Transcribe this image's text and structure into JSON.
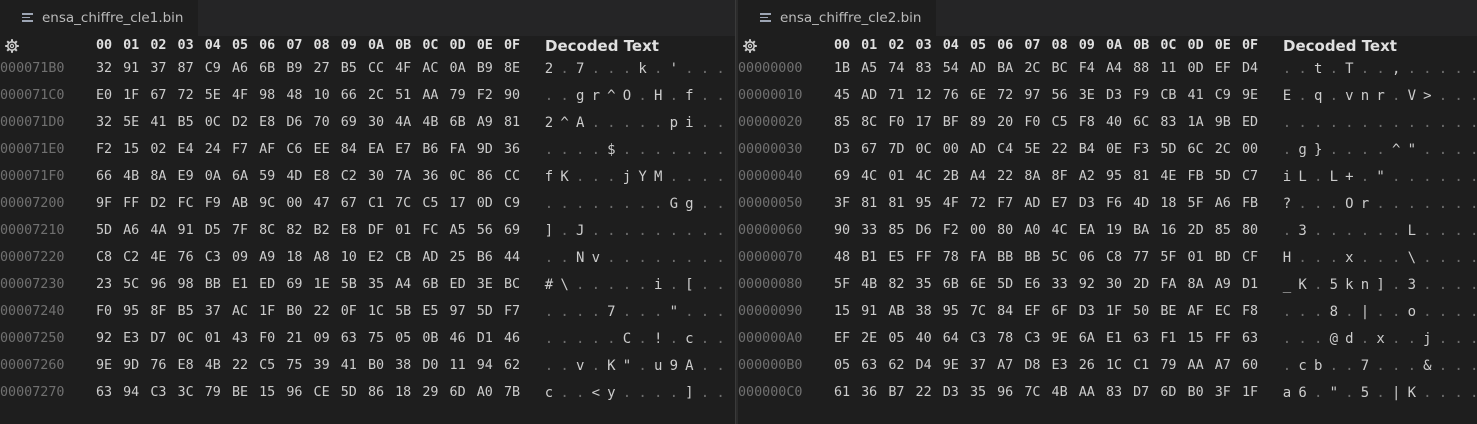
{
  "panes": [
    {
      "id": "left",
      "tab_title": "ensa_chiffre_cle1.bin",
      "header": {
        "columns": [
          "00",
          "01",
          "02",
          "03",
          "04",
          "05",
          "06",
          "07",
          "08",
          "09",
          "0A",
          "0B",
          "0C",
          "0D",
          "0E",
          "0F"
        ],
        "decoded_label": "Decoded Text"
      },
      "rows": [
        {
          "address": "000071B0",
          "bytes": [
            "32",
            "91",
            "37",
            "87",
            "C9",
            "A6",
            "6B",
            "B9",
            "27",
            "B5",
            "CC",
            "4F",
            "AC",
            "0A",
            "B9",
            "8E"
          ],
          "decoded": [
            "2",
            ".",
            "7",
            ".",
            ".",
            ".",
            "k",
            ".",
            "'",
            ".",
            ".",
            ".",
            ".",
            ".",
            ".",
            "."
          ]
        },
        {
          "address": "000071C0",
          "bytes": [
            "E0",
            "1F",
            "67",
            "72",
            "5E",
            "4F",
            "98",
            "48",
            "10",
            "66",
            "2C",
            "51",
            "AA",
            "79",
            "F2",
            "90"
          ],
          "decoded": [
            ".",
            ".",
            "g",
            "r",
            "^",
            "O",
            ".",
            "H",
            ".",
            "f",
            ".",
            ".",
            ".",
            ".",
            ".",
            "."
          ]
        },
        {
          "address": "000071D0",
          "bytes": [
            "32",
            "5E",
            "41",
            "B5",
            "0C",
            "D2",
            "E8",
            "D6",
            "70",
            "69",
            "30",
            "4A",
            "4B",
            "6B",
            "A9",
            "81"
          ],
          "decoded": [
            "2",
            "^",
            "A",
            ".",
            ".",
            ".",
            ".",
            ".",
            "p",
            "i",
            ".",
            ".",
            ".",
            ".",
            ".",
            "."
          ]
        },
        {
          "address": "000071E0",
          "bytes": [
            "F2",
            "15",
            "02",
            "E4",
            "24",
            "F7",
            "AF",
            "C6",
            "EE",
            "84",
            "EA",
            "E7",
            "B6",
            "FA",
            "9D",
            "36"
          ],
          "decoded": [
            ".",
            ".",
            ".",
            ".",
            "$",
            ".",
            ".",
            ".",
            ".",
            ".",
            ".",
            ".",
            ".",
            ".",
            ".",
            "."
          ]
        },
        {
          "address": "000071F0",
          "bytes": [
            "66",
            "4B",
            "8A",
            "E9",
            "0A",
            "6A",
            "59",
            "4D",
            "E8",
            "C2",
            "30",
            "7A",
            "36",
            "0C",
            "86",
            "CC"
          ],
          "decoded": [
            "f",
            "K",
            ".",
            ".",
            ".",
            "j",
            "Y",
            "M",
            ".",
            ".",
            ".",
            ".",
            ".",
            ".",
            ".",
            "."
          ]
        },
        {
          "address": "00007200",
          "bytes": [
            "9F",
            "FF",
            "D2",
            "FC",
            "F9",
            "AB",
            "9C",
            "00",
            "47",
            "67",
            "C1",
            "7C",
            "C5",
            "17",
            "0D",
            "C9"
          ],
          "decoded": [
            ".",
            ".",
            ".",
            ".",
            ".",
            ".",
            ".",
            ".",
            "G",
            "g",
            ".",
            ".",
            ".",
            ".",
            ".",
            "."
          ]
        },
        {
          "address": "00007210",
          "bytes": [
            "5D",
            "A6",
            "4A",
            "91",
            "D5",
            "7F",
            "8C",
            "82",
            "B2",
            "E8",
            "DF",
            "01",
            "FC",
            "A5",
            "56",
            "69"
          ],
          "decoded": [
            "]",
            ".",
            "J",
            ".",
            ".",
            ".",
            ".",
            ".",
            ".",
            ".",
            ".",
            ".",
            ".",
            ".",
            ".",
            "."
          ]
        },
        {
          "address": "00007220",
          "bytes": [
            "C8",
            "C2",
            "4E",
            "76",
            "C3",
            "09",
            "A9",
            "18",
            "A8",
            "10",
            "E2",
            "CB",
            "AD",
            "25",
            "B6",
            "44"
          ],
          "decoded": [
            ".",
            ".",
            "N",
            "v",
            ".",
            ".",
            ".",
            ".",
            ".",
            ".",
            ".",
            ".",
            ".",
            ".",
            ".",
            "."
          ]
        },
        {
          "address": "00007230",
          "bytes": [
            "23",
            "5C",
            "96",
            "98",
            "BB",
            "E1",
            "ED",
            "69",
            "1E",
            "5B",
            "35",
            "A4",
            "6B",
            "ED",
            "3E",
            "BC"
          ],
          "decoded": [
            "#",
            "\\",
            ".",
            ".",
            ".",
            ".",
            ".",
            "i",
            ".",
            "[",
            ".",
            ".",
            ".",
            ".",
            ".",
            "."
          ]
        },
        {
          "address": "00007240",
          "bytes": [
            "F0",
            "95",
            "8F",
            "B5",
            "37",
            "AC",
            "1F",
            "B0",
            "22",
            "0F",
            "1C",
            "5B",
            "E5",
            "97",
            "5D",
            "F7"
          ],
          "decoded": [
            ".",
            ".",
            ".",
            ".",
            "7",
            ".",
            ".",
            ".",
            "\"",
            ".",
            ".",
            ".",
            ".",
            ".",
            ".",
            "."
          ]
        },
        {
          "address": "00007250",
          "bytes": [
            "92",
            "E3",
            "D7",
            "0C",
            "01",
            "43",
            "F0",
            "21",
            "09",
            "63",
            "75",
            "05",
            "0B",
            "46",
            "D1",
            "46"
          ],
          "decoded": [
            ".",
            ".",
            ".",
            ".",
            ".",
            "C",
            ".",
            "!",
            ".",
            "c",
            ".",
            ".",
            ".",
            ".",
            ".",
            "."
          ]
        },
        {
          "address": "00007260",
          "bytes": [
            "9E",
            "9D",
            "76",
            "E8",
            "4B",
            "22",
            "C5",
            "75",
            "39",
            "41",
            "B0",
            "38",
            "D0",
            "11",
            "94",
            "62"
          ],
          "decoded": [
            ".",
            ".",
            "v",
            ".",
            "K",
            "\"",
            ".",
            "u",
            "9",
            "A",
            ".",
            ".",
            ".",
            ".",
            ".",
            "."
          ]
        },
        {
          "address": "00007270",
          "bytes": [
            "63",
            "94",
            "C3",
            "3C",
            "79",
            "BE",
            "15",
            "96",
            "CE",
            "5D",
            "86",
            "18",
            "29",
            "6D",
            "A0",
            "7B"
          ],
          "decoded": [
            "c",
            ".",
            ".",
            "<",
            "y",
            ".",
            ".",
            ".",
            ".",
            "]",
            ".",
            ".",
            ".",
            ".",
            ".",
            "."
          ]
        }
      ]
    },
    {
      "id": "right",
      "tab_title": "ensa_chiffre_cle2.bin",
      "header": {
        "columns": [
          "00",
          "01",
          "02",
          "03",
          "04",
          "05",
          "06",
          "07",
          "08",
          "09",
          "0A",
          "0B",
          "0C",
          "0D",
          "0E",
          "0F"
        ],
        "decoded_label": "Decoded Text"
      },
      "rows": [
        {
          "address": "00000000",
          "bytes": [
            "1B",
            "A5",
            "74",
            "83",
            "54",
            "AD",
            "BA",
            "2C",
            "BC",
            "F4",
            "A4",
            "88",
            "11",
            "0D",
            "EF",
            "D4"
          ],
          "decoded": [
            ".",
            ".",
            "t",
            ".",
            "T",
            ".",
            ".",
            ",",
            ".",
            ".",
            ".",
            ".",
            ".",
            ".",
            ".",
            "."
          ]
        },
        {
          "address": "00000010",
          "bytes": [
            "45",
            "AD",
            "71",
            "12",
            "76",
            "6E",
            "72",
            "97",
            "56",
            "3E",
            "D3",
            "F9",
            "CB",
            "41",
            "C9",
            "9E"
          ],
          "decoded": [
            "E",
            ".",
            "q",
            ".",
            "v",
            "n",
            "r",
            ".",
            "V",
            ">",
            ".",
            ".",
            ".",
            ".",
            ".",
            "."
          ]
        },
        {
          "address": "00000020",
          "bytes": [
            "85",
            "8C",
            "F0",
            "17",
            "BF",
            "89",
            "20",
            "F0",
            "C5",
            "F8",
            "40",
            "6C",
            "83",
            "1A",
            "9B",
            "ED"
          ],
          "decoded": [
            ".",
            ".",
            ".",
            ".",
            ".",
            ".",
            ".",
            ".",
            ".",
            ".",
            ".",
            ".",
            ".",
            ".",
            ".",
            "."
          ]
        },
        {
          "address": "00000030",
          "bytes": [
            "D3",
            "67",
            "7D",
            "0C",
            "00",
            "AD",
            "C4",
            "5E",
            "22",
            "B4",
            "0E",
            "F3",
            "5D",
            "6C",
            "2C",
            "00"
          ],
          "decoded": [
            ".",
            "g",
            "}",
            ".",
            ".",
            ".",
            ".",
            "^",
            "\"",
            ".",
            ".",
            ".",
            ".",
            ".",
            ".",
            "."
          ]
        },
        {
          "address": "00000040",
          "bytes": [
            "69",
            "4C",
            "01",
            "4C",
            "2B",
            "A4",
            "22",
            "8A",
            "8F",
            "A2",
            "95",
            "81",
            "4E",
            "FB",
            "5D",
            "C7"
          ],
          "decoded": [
            "i",
            "L",
            ".",
            "L",
            "+",
            ".",
            "\"",
            ".",
            ".",
            ".",
            ".",
            ".",
            ".",
            ".",
            ".",
            "."
          ]
        },
        {
          "address": "00000050",
          "bytes": [
            "3F",
            "81",
            "81",
            "95",
            "4F",
            "72",
            "F7",
            "AD",
            "E7",
            "D3",
            "F6",
            "4D",
            "18",
            "5F",
            "A6",
            "FB"
          ],
          "decoded": [
            "?",
            ".",
            ".",
            ".",
            "O",
            "r",
            ".",
            ".",
            ".",
            ".",
            ".",
            ".",
            ".",
            ".",
            ".",
            "."
          ]
        },
        {
          "address": "00000060",
          "bytes": [
            "90",
            "33",
            "85",
            "D6",
            "F2",
            "00",
            "80",
            "A0",
            "4C",
            "EA",
            "19",
            "BA",
            "16",
            "2D",
            "85",
            "80"
          ],
          "decoded": [
            ".",
            "3",
            ".",
            ".",
            ".",
            ".",
            ".",
            ".",
            "L",
            ".",
            ".",
            ".",
            ".",
            ".",
            ".",
            "."
          ]
        },
        {
          "address": "00000070",
          "bytes": [
            "48",
            "B1",
            "E5",
            "FF",
            "78",
            "FA",
            "BB",
            "BB",
            "5C",
            "06",
            "C8",
            "77",
            "5F",
            "01",
            "BD",
            "CF"
          ],
          "decoded": [
            "H",
            ".",
            ".",
            ".",
            "x",
            ".",
            ".",
            ".",
            "\\",
            ".",
            ".",
            ".",
            ".",
            ".",
            ".",
            "."
          ]
        },
        {
          "address": "00000080",
          "bytes": [
            "5F",
            "4B",
            "82",
            "35",
            "6B",
            "6E",
            "5D",
            "E6",
            "33",
            "92",
            "30",
            "2D",
            "FA",
            "8A",
            "A9",
            "D1"
          ],
          "decoded": [
            "_",
            "K",
            ".",
            "5",
            "k",
            "n",
            "]",
            ".",
            "3",
            ".",
            ".",
            ".",
            ".",
            ".",
            ".",
            "."
          ]
        },
        {
          "address": "00000090",
          "bytes": [
            "15",
            "91",
            "AB",
            "38",
            "95",
            "7C",
            "84",
            "EF",
            "6F",
            "D3",
            "1F",
            "50",
            "BE",
            "AF",
            "EC",
            "F8"
          ],
          "decoded": [
            ".",
            ".",
            ".",
            "8",
            ".",
            "|",
            ".",
            ".",
            "o",
            ".",
            ".",
            ".",
            ".",
            ".",
            ".",
            "."
          ]
        },
        {
          "address": "000000A0",
          "bytes": [
            "EF",
            "2E",
            "05",
            "40",
            "64",
            "C3",
            "78",
            "C3",
            "9E",
            "6A",
            "E1",
            "63",
            "F1",
            "15",
            "FF",
            "63"
          ],
          "decoded": [
            ".",
            ".",
            ".",
            "@",
            "d",
            ".",
            "x",
            ".",
            ".",
            "j",
            ".",
            ".",
            ".",
            ".",
            ".",
            "."
          ]
        },
        {
          "address": "000000B0",
          "bytes": [
            "05",
            "63",
            "62",
            "D4",
            "9E",
            "37",
            "A7",
            "D8",
            "E3",
            "26",
            "1C",
            "C1",
            "79",
            "AA",
            "A7",
            "60"
          ],
          "decoded": [
            ".",
            "c",
            "b",
            ".",
            ".",
            "7",
            ".",
            ".",
            ".",
            "&",
            ".",
            ".",
            ".",
            ".",
            ".",
            "."
          ]
        },
        {
          "address": "000000C0",
          "bytes": [
            "61",
            "36",
            "B7",
            "22",
            "D3",
            "35",
            "96",
            "7C",
            "4B",
            "AA",
            "83",
            "D7",
            "6D",
            "B0",
            "3F",
            "1F"
          ],
          "decoded": [
            "a",
            "6",
            ".",
            "\"",
            ".",
            "5",
            ".",
            "|",
            "K",
            ".",
            ".",
            ".",
            ".",
            ".",
            ".",
            "."
          ]
        }
      ]
    }
  ],
  "icons": {
    "tab_icon": "file-lines-icon",
    "settings_icon": "gear-icon"
  },
  "colors": {
    "background": "#1e1e1e",
    "text": "#cccccc",
    "address": "#707070",
    "header": "#e0e0e0"
  }
}
